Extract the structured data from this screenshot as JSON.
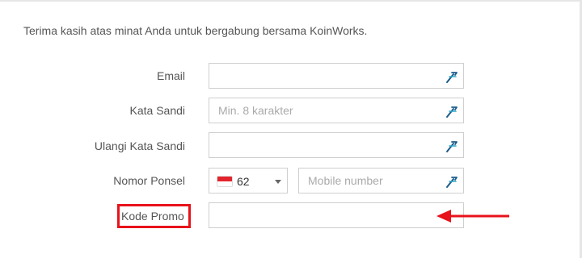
{
  "intro_text": "Terima kasih atas minat Anda untuk bergabung bersama KoinWorks.",
  "form": {
    "email": {
      "label": "Email",
      "value": "",
      "placeholder": ""
    },
    "password": {
      "label": "Kata Sandi",
      "value": "",
      "placeholder": "Min. 8 karakter"
    },
    "password_confirm": {
      "label": "Ulangi Kata Sandi",
      "value": "",
      "placeholder": ""
    },
    "phone": {
      "label": "Nomor Ponsel",
      "country_code": "62",
      "country": "Indonesia",
      "value": "",
      "placeholder": "Mobile number"
    },
    "promo": {
      "label": "Kode Promo",
      "value": "",
      "placeholder": ""
    }
  },
  "annotation": {
    "highlight_color": "#e8121b",
    "highlight_target": "Kode Promo"
  },
  "icons": {
    "field_icon": "lastpass-autofill-icon",
    "flag": "indonesia-flag-icon",
    "caret": "chevron-down-icon",
    "arrow": "arrow-left-icon"
  }
}
